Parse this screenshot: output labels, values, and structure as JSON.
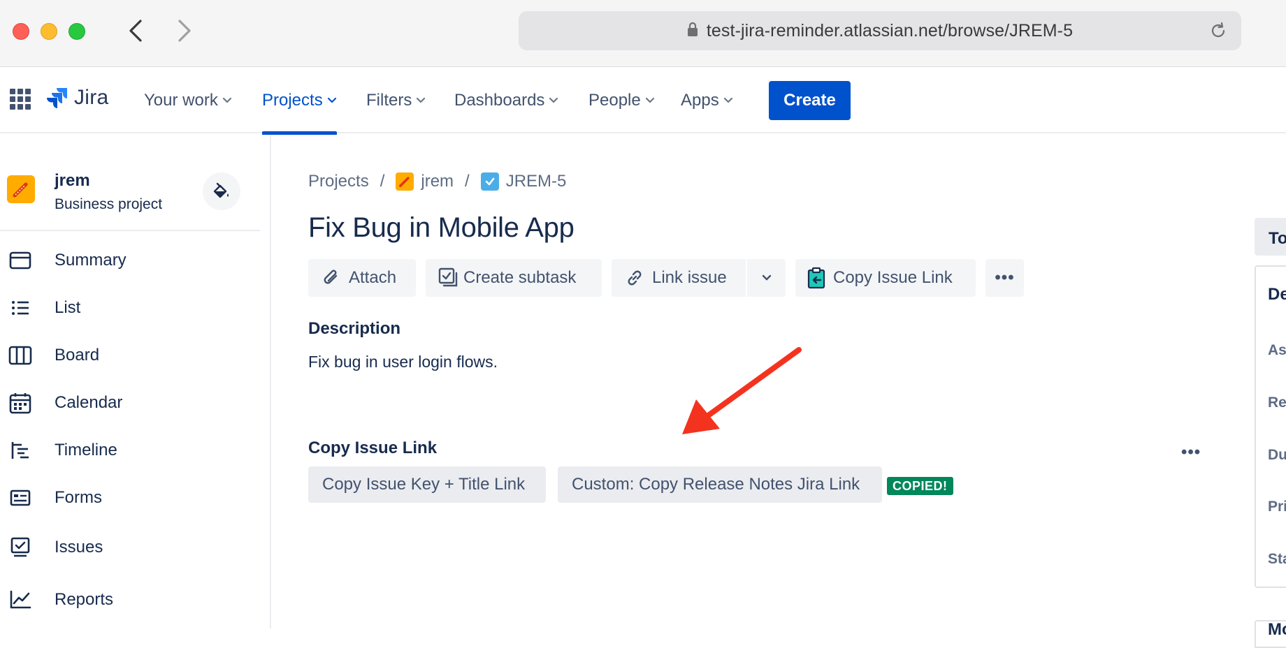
{
  "browser": {
    "url": "test-jira-reminder.atlassian.net/browse/JREM-5"
  },
  "topnav": {
    "logo_text": "Jira",
    "menu": [
      {
        "label": "Your work"
      },
      {
        "label": "Projects"
      },
      {
        "label": "Filters"
      },
      {
        "label": "Dashboards"
      },
      {
        "label": "People"
      },
      {
        "label": "Apps"
      }
    ],
    "active_menu": "Projects",
    "create_label": "Create"
  },
  "sidebar": {
    "project_name": "jrem",
    "project_type": "Business project",
    "items": [
      {
        "label": "Summary",
        "icon": "summary-icon"
      },
      {
        "label": "List",
        "icon": "list-icon"
      },
      {
        "label": "Board",
        "icon": "board-icon"
      },
      {
        "label": "Calendar",
        "icon": "calendar-icon"
      },
      {
        "label": "Timeline",
        "icon": "timeline-icon"
      },
      {
        "label": "Forms",
        "icon": "forms-icon"
      },
      {
        "label": "Issues",
        "icon": "issues-icon"
      },
      {
        "label": "Reports",
        "icon": "reports-icon"
      }
    ]
  },
  "breadcrumb": {
    "projects": "Projects",
    "project": "jrem",
    "issue_key": "JREM-5",
    "separator": "/"
  },
  "issue": {
    "title": "Fix Bug in Mobile App",
    "toolbar": {
      "attach": "Attach",
      "create_subtask": "Create subtask",
      "link_issue": "Link issue",
      "copy_issue_link": "Copy Issue Link",
      "more": "•••"
    },
    "description_label": "Description",
    "description_text": "Fix bug in user login flows."
  },
  "copy_panel": {
    "heading": "Copy Issue Link",
    "more": "•••",
    "buttons": [
      {
        "label": "Copy Issue Key + Title Link"
      },
      {
        "label": "Custom: Copy Release Notes Jira Link"
      }
    ],
    "badge": "COPIED!"
  },
  "right_panel": {
    "tab_partial": "To",
    "details_partial": "De",
    "fields_partial": [
      "As",
      "Re",
      "Du",
      "Pri",
      "Sta"
    ],
    "section2_partial": "Mo"
  },
  "colors": {
    "brand_blue": "#0052cc",
    "annotation_red": "#f4331f",
    "badge_green": "#00875a"
  }
}
